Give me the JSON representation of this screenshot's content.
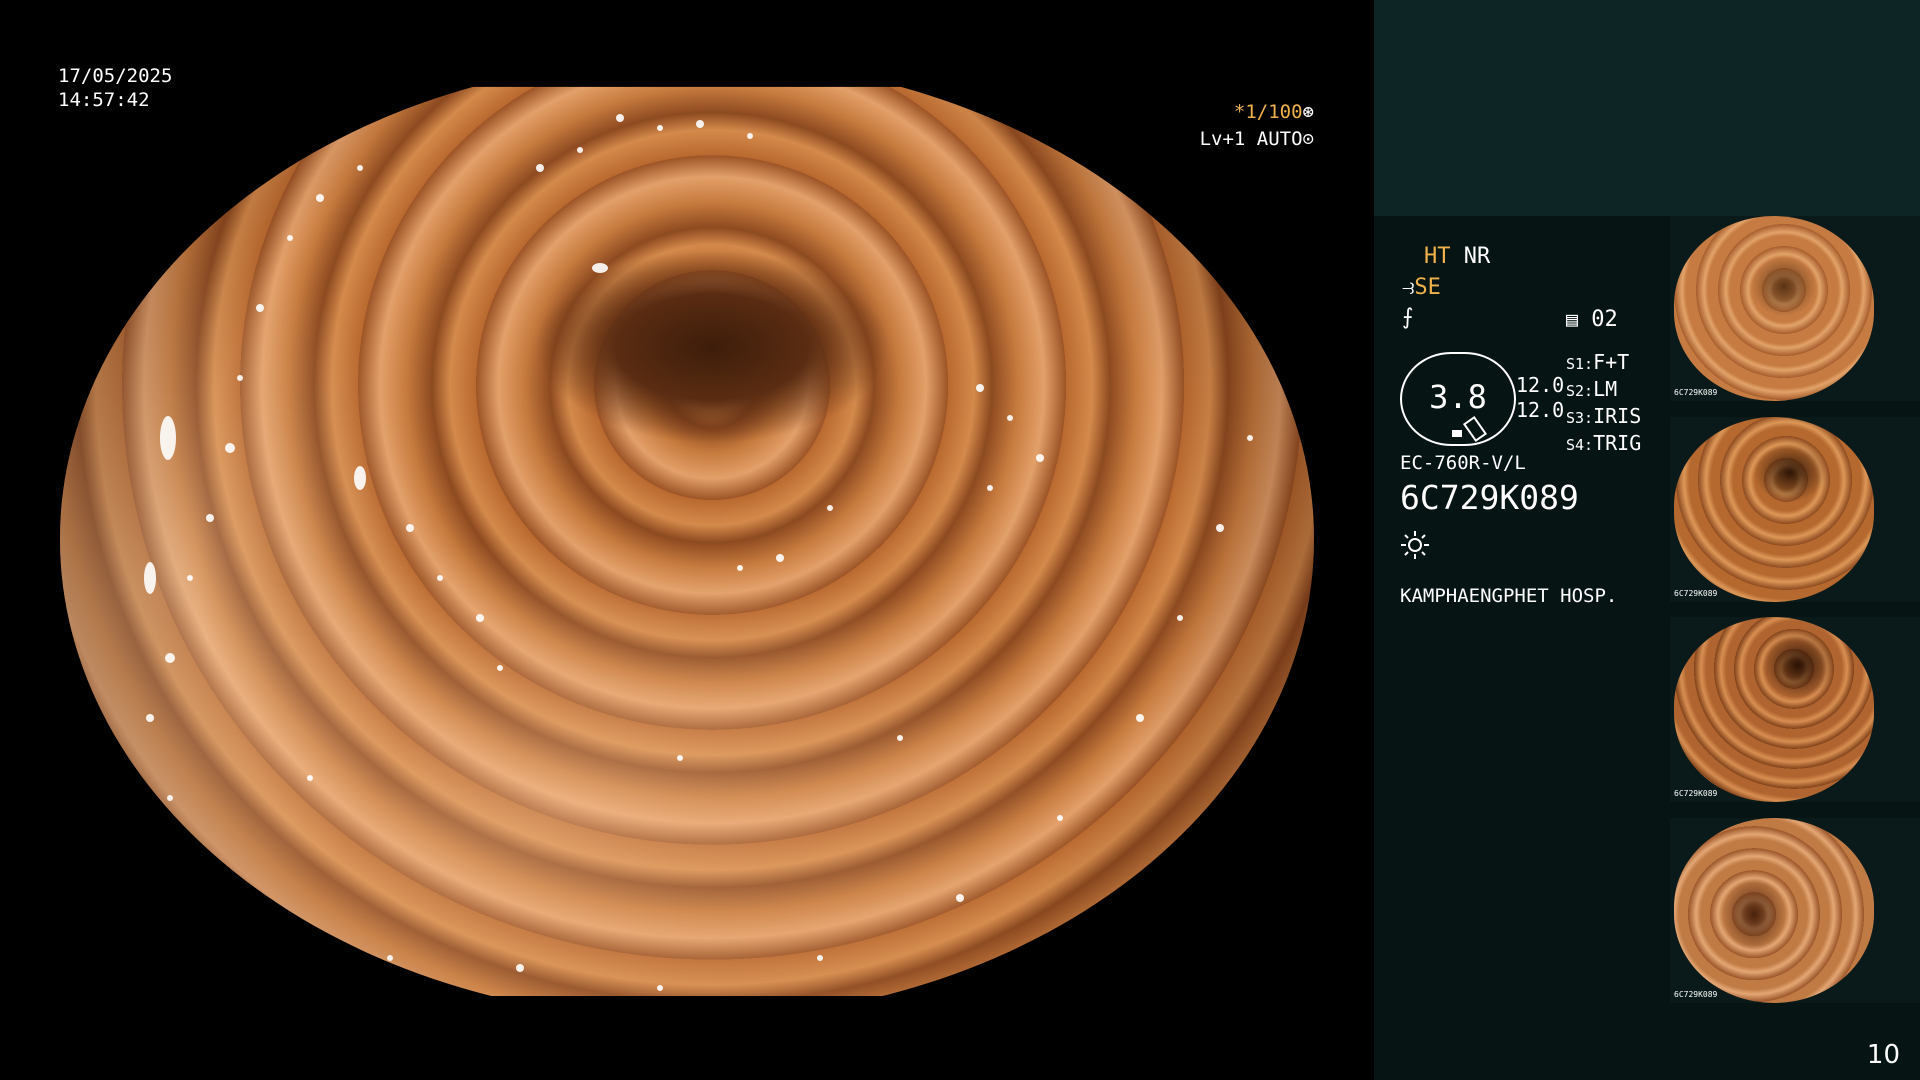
{
  "overlay": {
    "date": "17/05/2025",
    "time": "14:57:42",
    "shutter_speed": "*1/100",
    "shutter_symbol": "⊛",
    "level": "Lv+1 AUTO",
    "level_symbol": "⊙"
  },
  "panel": {
    "ht": "HT",
    "nr": "NR",
    "se_symbol": "⥽",
    "se": "SE",
    "aux_symbol": "⨍",
    "memory_icon": "memory-card-icon",
    "memory_count": "02",
    "gauge_value": "3.8",
    "values": [
      "12.0",
      "12.0"
    ],
    "slots": [
      {
        "key": "S1:",
        "label": "F+T"
      },
      {
        "key": "S2:",
        "label": "LM"
      },
      {
        "key": "S3:",
        "label": "IRIS"
      },
      {
        "key": "S4:",
        "label": "TRIG"
      }
    ],
    "model": "EC-760R-V/L",
    "serial": "6C729K089",
    "light_icon": "sun-icon",
    "hospital": "KAMPHAENGPHET HOSP."
  },
  "thumbnails": [
    {
      "label": "6C729K089"
    },
    {
      "label": "6C729K089"
    },
    {
      "label": "6C729K089"
    },
    {
      "label": "6C729K089"
    }
  ],
  "page_number": "10",
  "colors": {
    "accent_yellow": "#f0b24a",
    "panel_bg": "#061414",
    "panel_top_bg": "#0d2525"
  }
}
